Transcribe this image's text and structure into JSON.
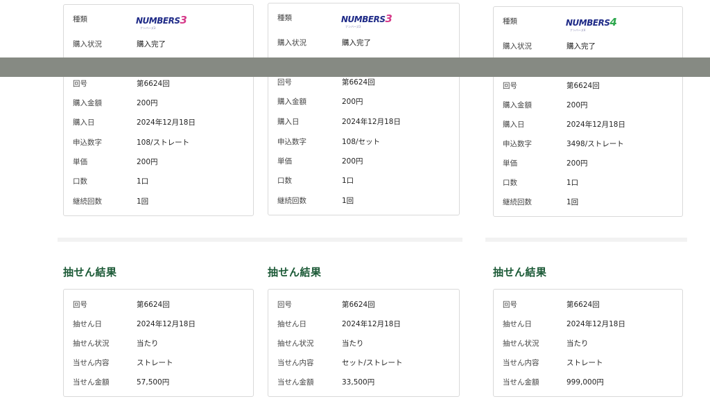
{
  "colors": {
    "section_title": "#1c5a37",
    "card_border": "#d9d9d9",
    "overlay": "#868a83",
    "logo_text": "#1e2a87",
    "numbers3_mark": "#d63b8a",
    "numbers4_mark": "#2fa84f"
  },
  "purchase_cards": [
    {
      "type_label": "種類",
      "logo": {
        "text": "NUMBERS",
        "digit": "3",
        "sub": "ナンバーズ3",
        "icon": "numbers3-logo"
      },
      "rows": [
        {
          "label": "購入状況",
          "value": "購入完了"
        },
        {
          "label": "回号",
          "value": "第6624回"
        },
        {
          "label": "購入金額",
          "value": "200円"
        },
        {
          "label": "購入日",
          "value": "2024年12月18日"
        },
        {
          "label": "申込数字",
          "value": "108/ストレート"
        },
        {
          "label": "単価",
          "value": "200円"
        },
        {
          "label": "口数",
          "value": "1口"
        },
        {
          "label": "継続回数",
          "value": "1回"
        }
      ]
    },
    {
      "type_label": "種類",
      "logo": {
        "text": "NUMBERS",
        "digit": "3",
        "sub": "ナンバーズ3",
        "icon": "numbers3-logo"
      },
      "rows": [
        {
          "label": "購入状況",
          "value": "購入完了"
        },
        {
          "label": "回号",
          "value": "第6624回"
        },
        {
          "label": "購入金額",
          "value": "200円"
        },
        {
          "label": "購入日",
          "value": "2024年12月18日"
        },
        {
          "label": "申込数字",
          "value": "108/セット"
        },
        {
          "label": "単価",
          "value": "200円"
        },
        {
          "label": "口数",
          "value": "1口"
        },
        {
          "label": "継続回数",
          "value": "1回"
        }
      ]
    },
    {
      "type_label": "種類",
      "logo": {
        "text": "NUMBERS",
        "digit": "4",
        "sub": "ナンバーズ4",
        "icon": "numbers4-logo"
      },
      "rows": [
        {
          "label": "購入状況",
          "value": "購入完了"
        },
        {
          "label": "回号",
          "value": "第6624回"
        },
        {
          "label": "購入金額",
          "value": "200円"
        },
        {
          "label": "購入日",
          "value": "2024年12月18日"
        },
        {
          "label": "申込数字",
          "value": "3498/ストレート"
        },
        {
          "label": "単価",
          "value": "200円"
        },
        {
          "label": "口数",
          "value": "1口"
        },
        {
          "label": "継続回数",
          "value": "1回"
        }
      ]
    }
  ],
  "result_sections": [
    {
      "title": "抽せん結果",
      "rows": [
        {
          "label": "回号",
          "value": "第6624回"
        },
        {
          "label": "抽せん日",
          "value": "2024年12月18日"
        },
        {
          "label": "抽せん状況",
          "value": "当たり"
        },
        {
          "label": "当せん内容",
          "value": "ストレート"
        },
        {
          "label": "当せん金額",
          "value": "57,500円"
        }
      ]
    },
    {
      "title": "抽せん結果",
      "rows": [
        {
          "label": "回号",
          "value": "第6624回"
        },
        {
          "label": "抽せん日",
          "value": "2024年12月18日"
        },
        {
          "label": "抽せん状況",
          "value": "当たり"
        },
        {
          "label": "当せん内容",
          "value": "セット/ストレート"
        },
        {
          "label": "当せん金額",
          "value": "33,500円"
        }
      ]
    },
    {
      "title": "抽せん結果",
      "rows": [
        {
          "label": "回号",
          "value": "第6624回"
        },
        {
          "label": "抽せん日",
          "value": "2024年12月18日"
        },
        {
          "label": "抽せん状況",
          "value": "当たり"
        },
        {
          "label": "当せん内容",
          "value": "ストレート"
        },
        {
          "label": "当せん金額",
          "value": "999,000円"
        }
      ]
    }
  ]
}
